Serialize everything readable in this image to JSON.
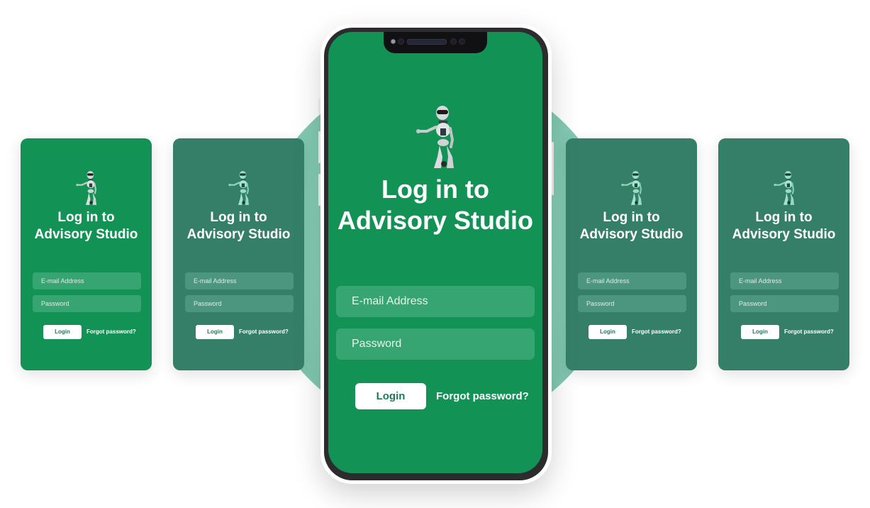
{
  "login_screen": {
    "title_line1": "Log in to",
    "title_line2": "Advisory Studio",
    "email_placeholder": "E-mail Address",
    "password_placeholder": "Password",
    "login_label": "Login",
    "forgot_label": "Forgot password?",
    "robot_icon": "robot-mascot-icon"
  },
  "colors": {
    "bright_green": "#139256",
    "muted_green": "#357f69",
    "circle_mint": "#86ceb6"
  },
  "cards": [
    {
      "variant": "bright"
    },
    {
      "variant": "muted"
    },
    {
      "variant": "muted"
    },
    {
      "variant": "muted"
    }
  ]
}
